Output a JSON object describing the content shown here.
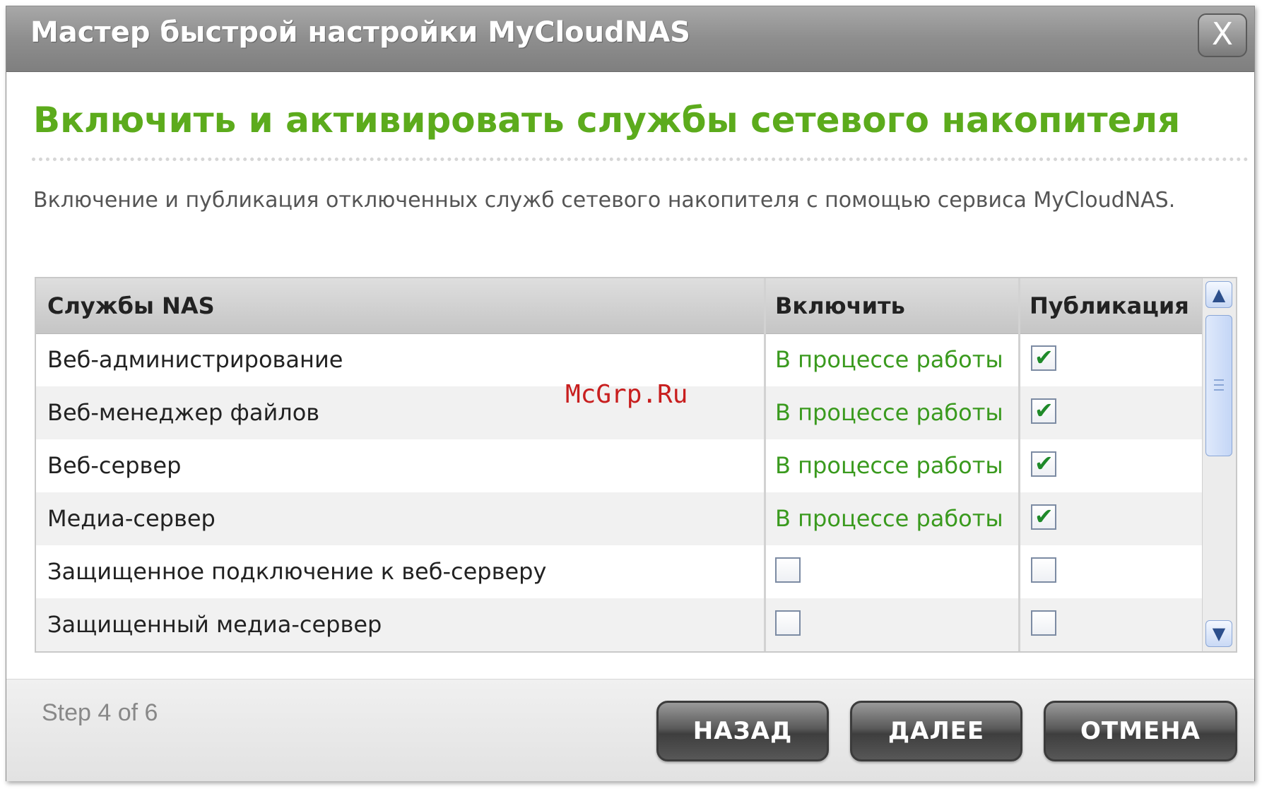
{
  "window": {
    "title": "Мастер быстрой настройки MyCloudNAS",
    "close_label": "X"
  },
  "heading": "Включить и активировать службы сетевого накопителя",
  "description": "Включение и публикация отключенных служб сетевого накопителя с помощью сервиса MyCloudNAS.",
  "table": {
    "columns": [
      "Службы NAS",
      "Включить",
      "Публикация"
    ],
    "rows": [
      {
        "service": "Веб-администрирование",
        "enable_status": "В процессе работы",
        "enabled": true,
        "publish": true
      },
      {
        "service": "Веб-менеджер файлов",
        "enable_status": "В процессе работы",
        "enabled": true,
        "publish": true
      },
      {
        "service": "Веб-сервер",
        "enable_status": "В процессе работы",
        "enabled": true,
        "publish": true
      },
      {
        "service": "Медиа-сервер",
        "enable_status": "В процессе работы",
        "enabled": true,
        "publish": true
      },
      {
        "service": "Защищенное подключение к веб-серверу",
        "enable_status": "",
        "enabled": false,
        "publish": false
      },
      {
        "service": "Защищенный медиа-сервер",
        "enable_status": "",
        "enabled": false,
        "publish": false
      }
    ]
  },
  "footer": {
    "step": "Step 4 of 6",
    "back_label": "НАЗАД",
    "next_label": "ДАЛЕЕ",
    "cancel_label": "ОТМЕНА"
  },
  "watermark": "McGrp.Ru",
  "colors": {
    "heading": "#5cab1c",
    "status": "#3a9a1e",
    "checkmark": "#1f8a2a"
  },
  "icons": {
    "check": "✔",
    "scroll_up": "▲",
    "scroll_down": "▼"
  }
}
